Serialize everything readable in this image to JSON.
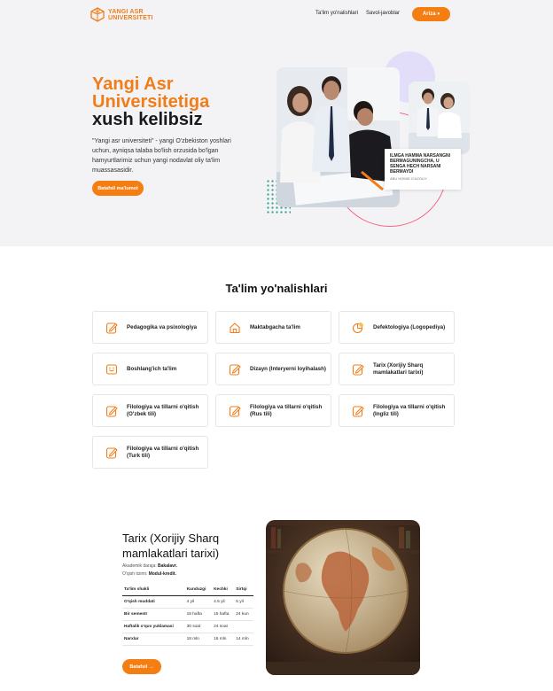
{
  "header": {
    "logo_line1": "YANGI ASR",
    "logo_line2": "UNIVERSITETI",
    "nav": [
      "Ta'lim yo'nalishlari",
      "Savol-javoblar"
    ],
    "cta_label": "Ariza",
    "cta_icon": "chevron-down-icon",
    "accent_color": "#f57e12"
  },
  "hero": {
    "title_line1": "Yangi Asr",
    "title_line2": "Universitetiga",
    "title_line3": "xush kelibsiz",
    "description": "\"Yangi asr universiteti\" - yangi O'zbekiston yoshlari uchun, ayniqsa talaba bo'lish orzusida bo'lgan hamyurtlarimiz uchun yangi nodavlat oliy ta'lim muassasasidir.",
    "button_label": "Batafsil ma'lumot",
    "quote": "ILMGA HAMMA NARSANGNI BERMAGUNINGCHA, U SENGA HECH NARSANI BERMAYDI",
    "quote_author": "ABU HOMID G'AZOLIY"
  },
  "programs": {
    "title": "Ta'lim yo'nalishlari",
    "items": [
      {
        "label": "Pedagogika va psixologiya",
        "icon": "edit-note-icon"
      },
      {
        "label": "Maktabgacha ta'lim",
        "icon": "house-icon"
      },
      {
        "label": "Defektologiya (Logopediya)",
        "icon": "chart-pie-icon"
      },
      {
        "label": "Boshlang'ich ta'lim",
        "icon": "smiley-board-icon"
      },
      {
        "label": "Dizayn (Interyerni loyihalash)",
        "icon": "edit-note-icon"
      },
      {
        "label": "Tarix (Xorijiy Sharq mamlakatlari tarixi)",
        "icon": "edit-note-icon"
      },
      {
        "label": "Filologiya va tillarni o'qitish (O'zbek tili)",
        "icon": "edit-note-icon"
      },
      {
        "label": "Filologiya va tillarni o'qitish (Rus tili)",
        "icon": "edit-note-icon"
      },
      {
        "label": "Filologiya va tillarni o'qitish (Ingliz tili)",
        "icon": "edit-note-icon"
      },
      {
        "label": "Filologiya va tillarni o'qitish (Turk tili)",
        "icon": "edit-note-icon"
      }
    ]
  },
  "detail": {
    "title": "Tarix (Xorijiy Sharq mamlakatlari tarixi)",
    "degree_label": "Akademik daraja:",
    "degree_value": "Bakalavr.",
    "system_label": "O'qish tizimi:",
    "system_value": "Modul-kredit.",
    "table": {
      "headers": [
        "Ta'lim shakli",
        "Kunduzgi",
        "Kechki",
        "Sirtqi"
      ],
      "rows": [
        [
          "O'qish muddati",
          "4 yil",
          "4.5 yil",
          "5 yil"
        ],
        [
          "Bir semestr",
          "15 hafta",
          "15 hafta",
          "24 kun"
        ],
        [
          "Haftalik o'quv yuklamasi",
          "30 soat",
          "24 soat",
          ""
        ],
        [
          "Narxlar",
          "18 mln",
          "16 mln",
          "14 mln"
        ]
      ]
    },
    "button_label": "Batafsil",
    "button_icon": "arrow-right-icon"
  }
}
